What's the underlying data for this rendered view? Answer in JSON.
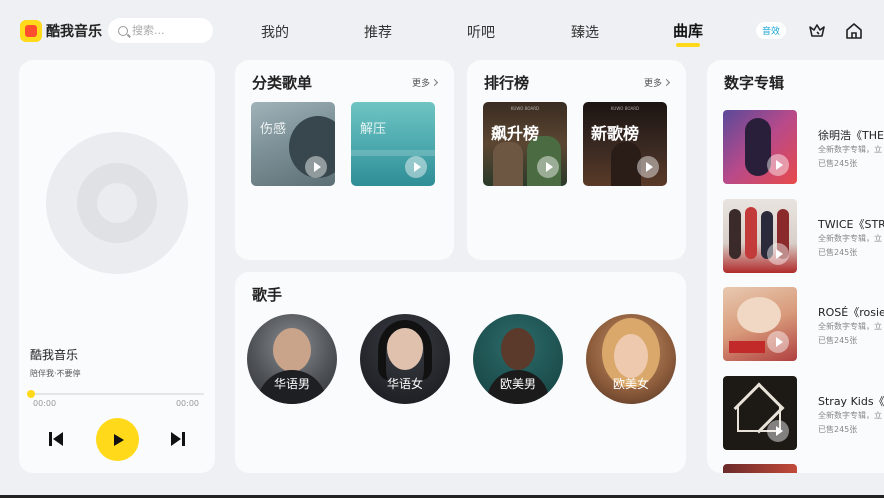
{
  "header": {
    "app_name": "酷我音乐",
    "search_placeholder": "搜索...",
    "tabs": [
      {
        "label": "我的",
        "active": false
      },
      {
        "label": "推荐",
        "active": false
      },
      {
        "label": "听吧",
        "active": false
      },
      {
        "label": "臻选",
        "active": false
      },
      {
        "label": "曲库",
        "active": true
      }
    ],
    "sound_badge": "音效",
    "icons": [
      "crown-icon",
      "home-icon"
    ],
    "accent_color": "#ffd91a"
  },
  "player": {
    "song_title": "酷我音乐",
    "song_subtitle": "陪伴我·不要停",
    "time_current": "00:00",
    "time_total": "00:00",
    "progress": 0,
    "icons": [
      "previous-icon",
      "play-icon",
      "next-icon"
    ]
  },
  "categories": {
    "title": "分类歌单",
    "more": "更多",
    "items": [
      {
        "label": "伤感"
      },
      {
        "label": "解压"
      }
    ]
  },
  "charts": {
    "title": "排行榜",
    "more": "更多",
    "items": [
      {
        "label": "飙升榜",
        "caption": "KUWO BOARD"
      },
      {
        "label": "新歌榜",
        "caption": "KUWO BOARD"
      }
    ]
  },
  "singers": {
    "title": "歌手",
    "items": [
      {
        "label": "华语男"
      },
      {
        "label": "华语女"
      },
      {
        "label": "欧美男"
      },
      {
        "label": "欧美女"
      }
    ]
  },
  "digital_albums": {
    "title": "数字专辑",
    "items": [
      {
        "title": "徐明浩《THE",
        "desc": "全新数字专辑，立",
        "sold": "已售245张"
      },
      {
        "title": "TWICE《STR",
        "desc": "全新数字专辑，立",
        "sold": "已售245张"
      },
      {
        "title": "ROSÉ《rosie",
        "desc": "全新数字专辑，立",
        "sold": "已售245张"
      },
      {
        "title": "Stray Kids《合",
        "desc": "全新数字专辑，立",
        "sold": "已售245张"
      }
    ]
  }
}
